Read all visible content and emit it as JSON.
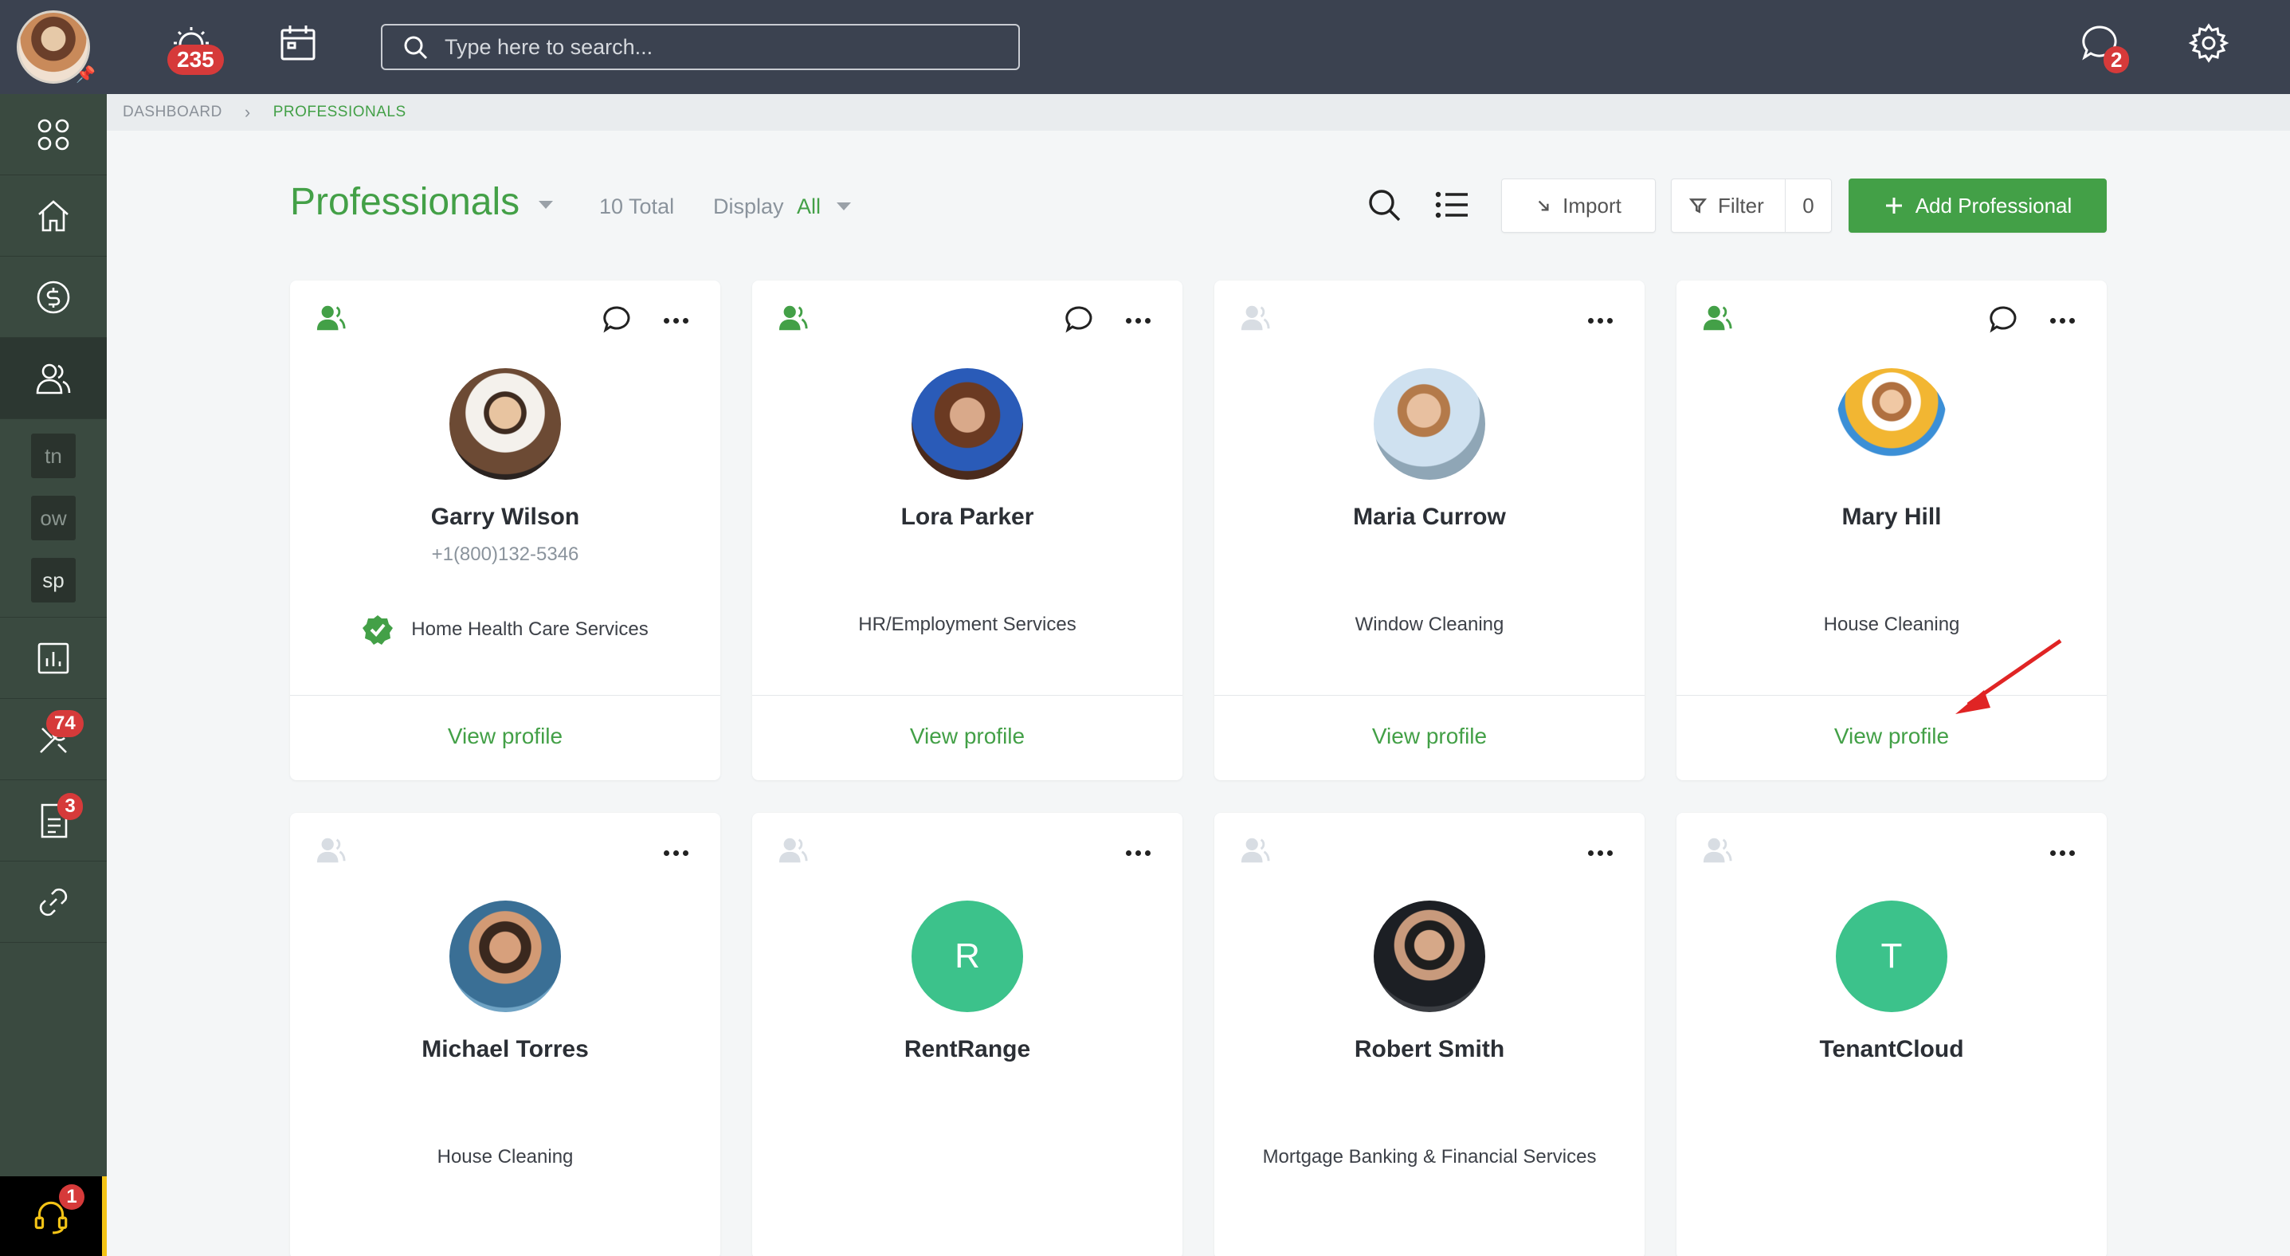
{
  "sidebar": {
    "shortcuts": [
      "tn",
      "ow",
      "sp"
    ],
    "badges": {
      "tools": "74",
      "docs": "3",
      "help": "1"
    }
  },
  "topbar": {
    "notifications_badge": "235",
    "search_placeholder": "Type here to search...",
    "chat_badge": "2"
  },
  "breadcrumb": {
    "home": "DASHBOARD",
    "current": "PROFESSIONALS"
  },
  "header": {
    "title": "Professionals",
    "total": "10 Total",
    "display_label": "Display",
    "display_value": "All",
    "import_label": "Import",
    "filter_label": "Filter",
    "filter_count": "0",
    "add_label": "Add Professional"
  },
  "cards": [
    {
      "name": "Garry Wilson",
      "phone": "+1(800)132-5346",
      "service": "Home Health Care Services",
      "verified": true,
      "active": true,
      "chat": true,
      "link": "View profile",
      "avatar": "photo"
    },
    {
      "name": "Lora Parker",
      "phone": "",
      "service": "HR/Employment Services",
      "verified": false,
      "active": true,
      "chat": true,
      "link": "View profile",
      "avatar": "photo"
    },
    {
      "name": "Maria Currow",
      "phone": "",
      "service": "Window Cleaning",
      "verified": false,
      "active": false,
      "chat": false,
      "link": "View profile",
      "avatar": "photo"
    },
    {
      "name": "Mary Hill",
      "phone": "",
      "service": "House Cleaning",
      "verified": false,
      "active": true,
      "chat": true,
      "link": "View profile",
      "avatar": "photo"
    },
    {
      "name": "Michael Torres",
      "phone": "",
      "service": "House Cleaning",
      "verified": false,
      "active": false,
      "chat": false,
      "avatar": "photo"
    },
    {
      "name": "RentRange",
      "phone": "",
      "service": "",
      "verified": false,
      "active": false,
      "chat": false,
      "avatar": "R"
    },
    {
      "name": "Robert Smith",
      "phone": "",
      "service": "Mortgage Banking & Financial Services",
      "verified": false,
      "active": false,
      "chat": false,
      "avatar": "photo"
    },
    {
      "name": "TenantCloud",
      "phone": "",
      "service": "",
      "verified": false,
      "active": false,
      "chat": false,
      "avatar": "T"
    }
  ],
  "colors": {
    "accent": "#43a047",
    "sidebar": "#3a4a40",
    "topbar": "#3b4250",
    "badge": "#d63a3a",
    "initials_bg": "#3cc28b"
  }
}
